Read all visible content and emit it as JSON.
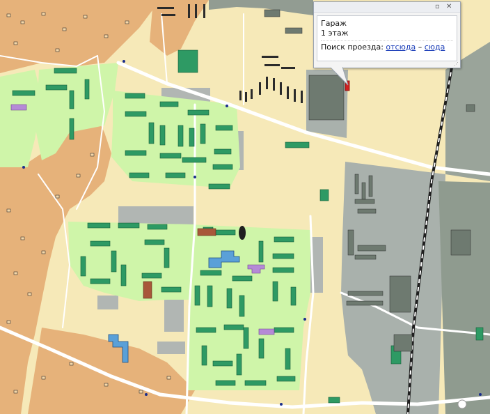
{
  "popup": {
    "title": "Гараж",
    "floors": "1 этаж",
    "route_label": "Поиск проезда:",
    "from_here": "отсюда",
    "dash": "–",
    "to_here": "сюда",
    "minimize_glyph": "▫",
    "close_glyph": "✕"
  },
  "colors": {
    "water_bg": "#f5e6b3",
    "private_sector": "#e7b47c",
    "residential_green": "#cdf5a8",
    "industrial_gray": "#a6aeaa",
    "dark_gray_zone": "#8e9a90",
    "building_green": "#2e9a64",
    "building_blue": "#5aa0d8",
    "building_violet": "#b58ad6",
    "building_brown": "#a8573a",
    "garage_dark": "#2c2c2c",
    "selected_red": "#d02020",
    "road": "#ffffff",
    "railway": "#222222"
  }
}
